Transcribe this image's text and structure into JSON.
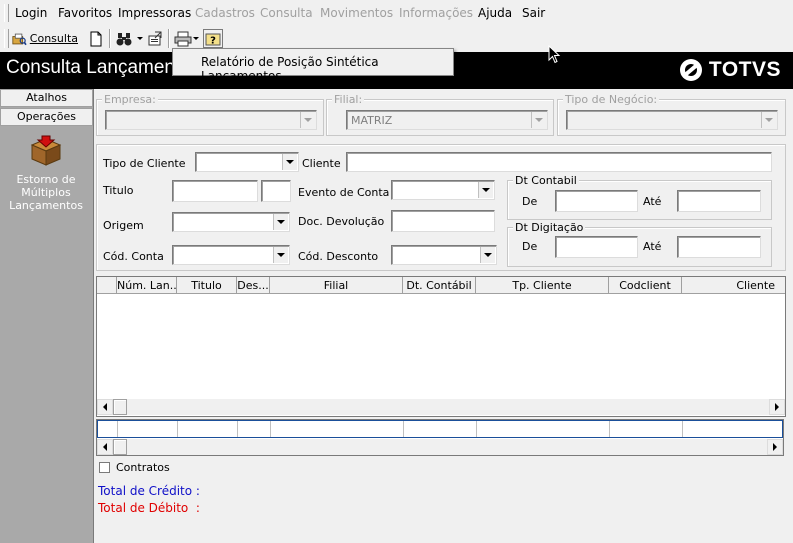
{
  "menu": {
    "items": [
      {
        "label": "Login",
        "enabled": true
      },
      {
        "label": "Favoritos",
        "enabled": true
      },
      {
        "label": "Impressoras",
        "enabled": true
      },
      {
        "label": "Cadastros",
        "enabled": false
      },
      {
        "label": "Consulta",
        "enabled": false
      },
      {
        "label": "Movimentos",
        "enabled": false
      },
      {
        "label": "Informações",
        "enabled": false
      },
      {
        "label": "Ajuda",
        "enabled": true
      },
      {
        "label": "Sair",
        "enabled": true
      }
    ]
  },
  "toolbar": {
    "consulta_label": "Consulta",
    "icons": [
      "consulta-icon",
      "new-document-icon",
      "binoculars-icon",
      "export-icon",
      "printer-icon",
      "help-icon"
    ]
  },
  "dropdown": {
    "item": "Relatório de Posição Sintética Lançamentos"
  },
  "window": {
    "title": "Consulta Lançamentos",
    "logo_text": "TOTVS"
  },
  "left_panel": {
    "tabs": [
      "Atalhos",
      "Operações"
    ],
    "item_label": "Estorno de Múltiplos Lançamentos"
  },
  "filters_top": {
    "empresa_label": "Empresa:",
    "filial_label": "Filial:",
    "filial_value": "MATRIZ",
    "tipo_negocio_label": "Tipo de Negócio:"
  },
  "filters": {
    "tipo_cliente": "Tipo de Cliente",
    "cliente": "Cliente",
    "titulo": "Titulo",
    "evento_conta": "Evento de Conta",
    "origem": "Origem",
    "doc_devolucao": "Doc. Devolução",
    "cod_conta": "Cód. Conta",
    "cod_desconto": "Cód. Desconto",
    "dt_contabil": "Dt Contabil",
    "dt_digitacao": "Dt Digitação",
    "de": "De",
    "ate": "Até"
  },
  "grid": {
    "columns": [
      "Núm. Lan...",
      "Titulo",
      "Des...",
      "Filial",
      "Dt. Contábil",
      "Tp. Cliente",
      "Codclient",
      "Cliente"
    ]
  },
  "footer": {
    "contratos": "Contratos",
    "total_credito": "Total de Crédito :",
    "total_debito": "Total de Débito  :",
    "credit_color": "#1010c8",
    "debit_color": "#e00000"
  }
}
